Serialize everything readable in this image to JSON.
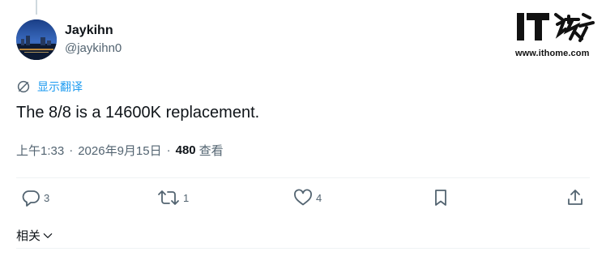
{
  "author": {
    "display_name": "Jaykihn",
    "handle": "@jaykihn0"
  },
  "watermark": {
    "logo_text": "IT之家",
    "url": "www.ithome.com"
  },
  "translate_label": "显示翻译",
  "tweet_text": "The 8/8 is a 14600K replacement.",
  "meta": {
    "time": "上午1:33",
    "separator": "·",
    "date": "2026年9月15日",
    "views_count": "480",
    "views_label": "查看"
  },
  "actions": {
    "replies": "3",
    "retweets": "1",
    "likes": "4"
  },
  "related_label": "相关",
  "colors": {
    "accent": "#1d9bf0",
    "muted": "#536471",
    "text": "#0f1419",
    "divider": "#eff3f4"
  },
  "icons": [
    "translate-icon",
    "reply-icon",
    "retweet-icon",
    "like-icon",
    "bookmark-icon",
    "share-icon",
    "chevron-down-icon"
  ]
}
